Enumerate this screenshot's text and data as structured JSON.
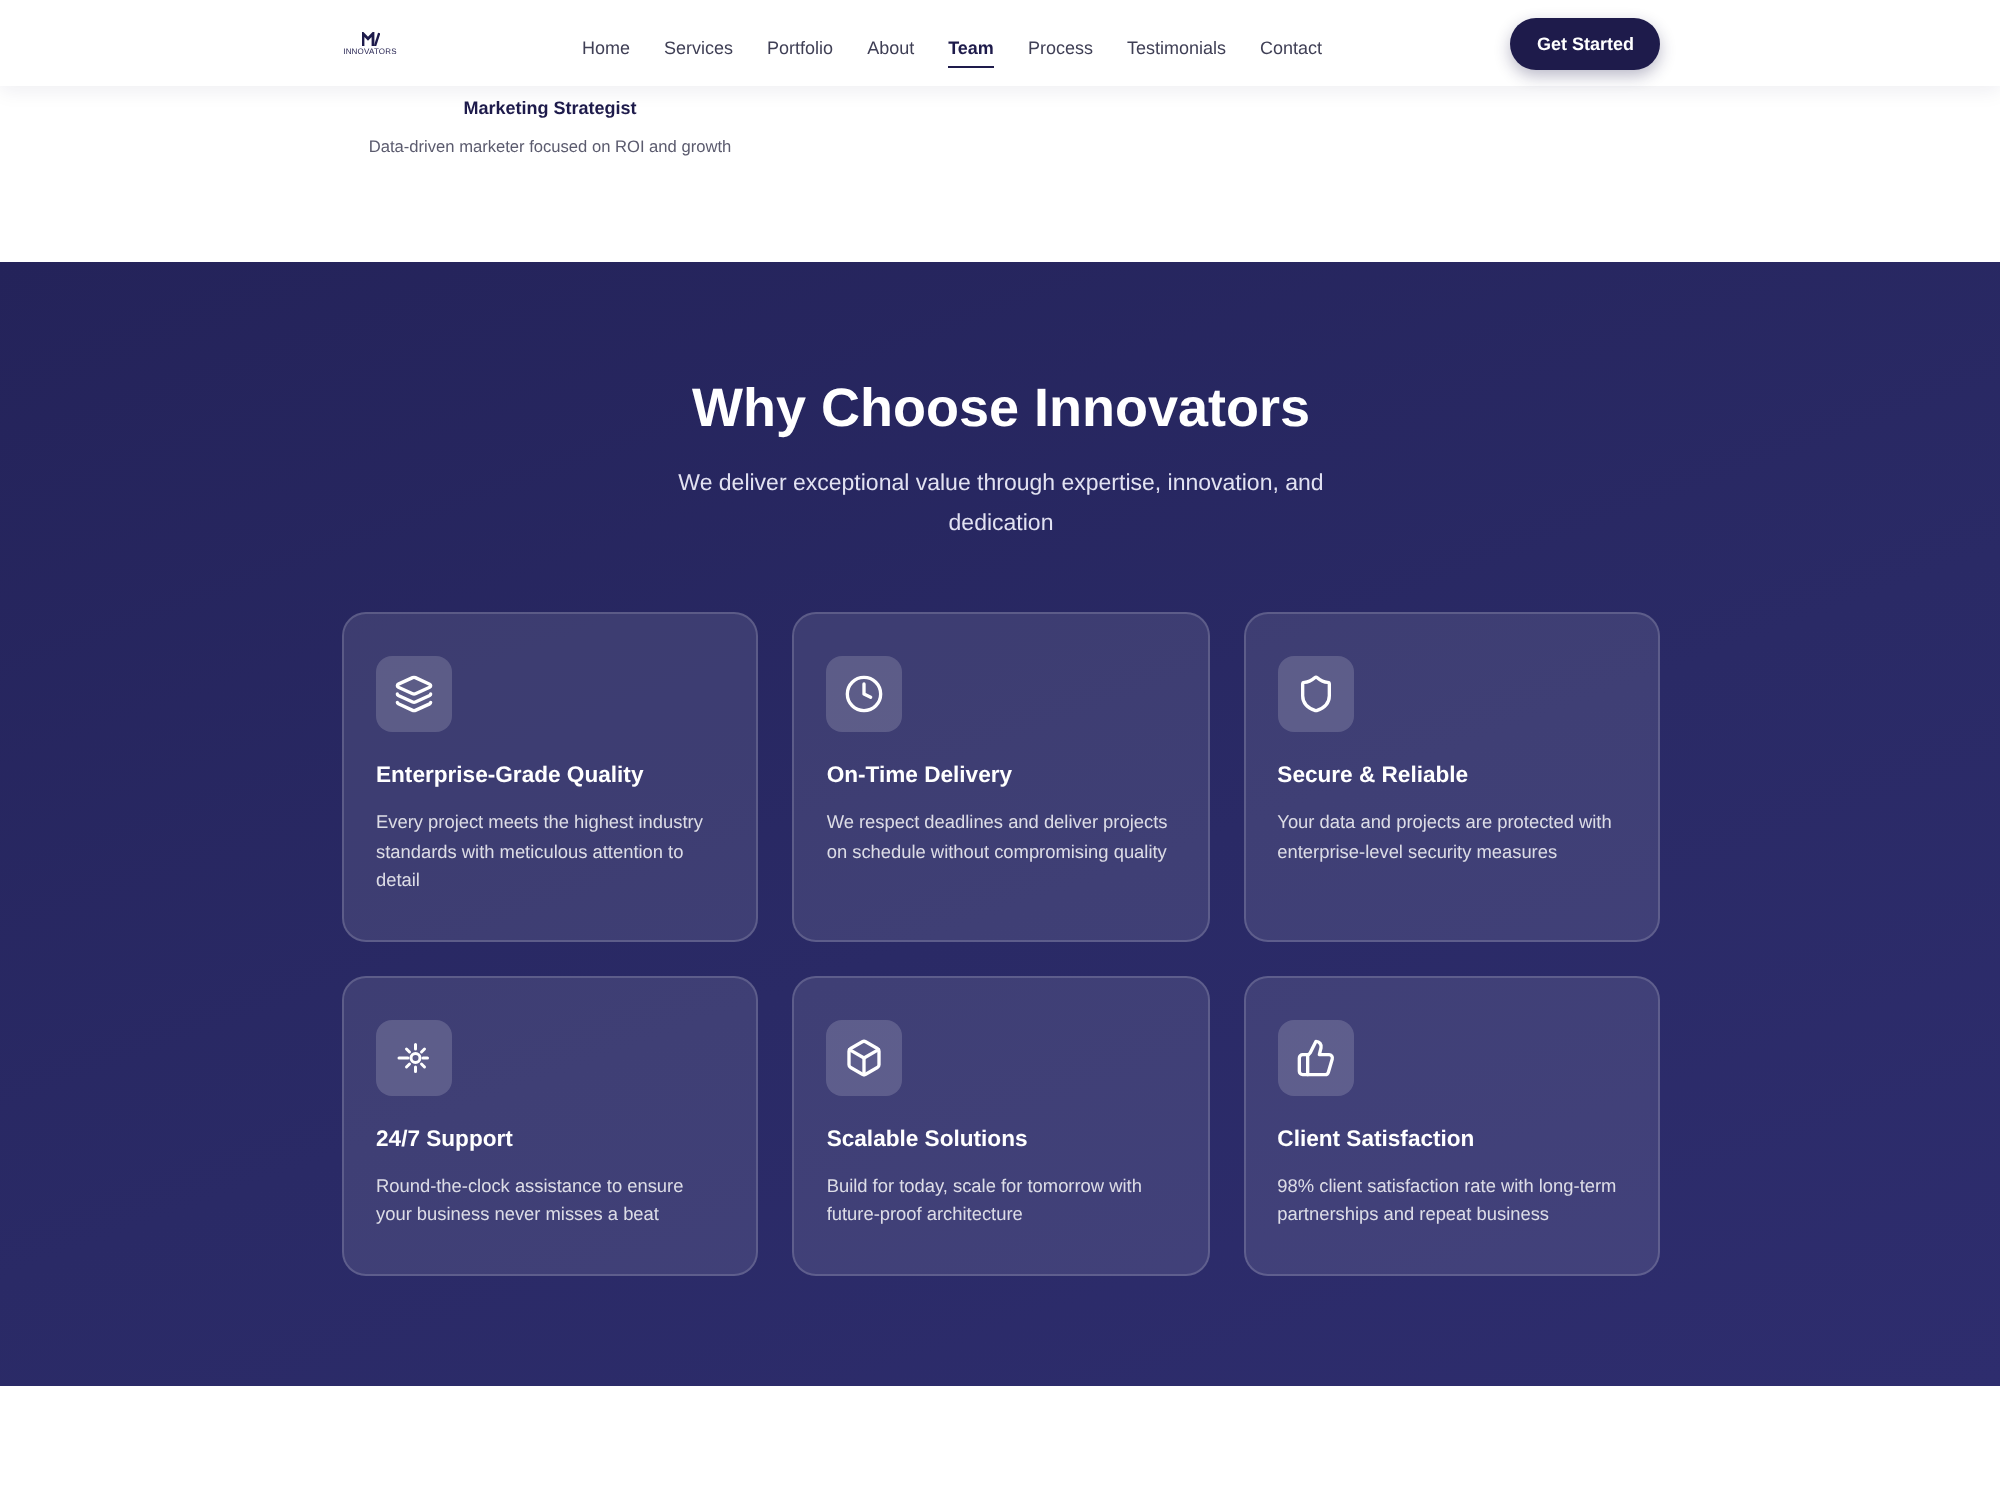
{
  "nav": {
    "logo": {
      "text": "INNOVATORS"
    },
    "links": [
      {
        "label": "Home",
        "selected": false
      },
      {
        "label": "Services",
        "selected": false
      },
      {
        "label": "Portfolio",
        "selected": false
      },
      {
        "label": "About",
        "selected": false
      },
      {
        "label": "Team",
        "selected": true
      },
      {
        "label": "Process",
        "selected": false
      },
      {
        "label": "Testimonials",
        "selected": false
      },
      {
        "label": "Contact",
        "selected": false
      }
    ],
    "cta": "Get Started"
  },
  "team_member": {
    "role": "Marketing Strategist",
    "bio": "Data-driven marketer focused on ROI and growth"
  },
  "features": {
    "title": "Why Choose Innovators",
    "subtitle": "We deliver exceptional value through expertise, innovation, and dedication",
    "cards": [
      {
        "kind": "layers",
        "title": "Enterprise-Grade Quality",
        "description": "Every project meets the highest industry standards with meticulous attention to detail"
      },
      {
        "kind": "clock",
        "title": "On-Time Delivery",
        "description": "We respect deadlines and deliver projects on schedule without compromising quality"
      },
      {
        "kind": "shield",
        "title": "Secure & Reliable",
        "description": "Your data and projects are protected with enterprise-level security measures"
      },
      {
        "kind": "burst",
        "title": "24/7 Support",
        "description": "Round-the-clock assistance to ensure your business never misses a beat"
      },
      {
        "kind": "box",
        "title": "Scalable Solutions",
        "description": "Build for today, scale for tomorrow with future-proof architecture"
      },
      {
        "kind": "thumbs-up",
        "title": "Client Satisfaction",
        "description": "98% client satisfaction rate with long-term partnerships and repeat business"
      }
    ]
  }
}
